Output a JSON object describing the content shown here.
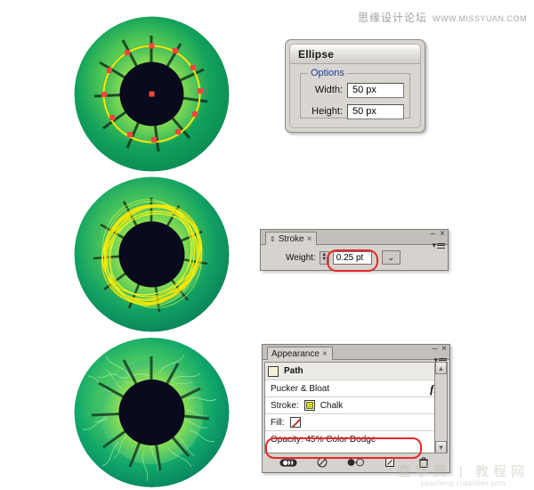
{
  "watermarks": {
    "top_cn": "思缘设计论坛",
    "top_url": "WWW.MISSYUAN.COM",
    "bottom_cn": "查字典 | 教程网",
    "bottom_url": "jiaocheng.chazidian.com"
  },
  "colors": {
    "iris_outer": "#0e9456",
    "iris_mid": "#16a95f",
    "iris_inner": "#8fe050",
    "pupil": "#090a1e",
    "path_stroke": "#ffe400",
    "anchor_point": "#f4473c",
    "highlight_red": "#e8262a",
    "legend_blue": "#1b3f9c",
    "stroke_swatch": "#cfd428",
    "path_swatch": "#f5f3d4"
  },
  "eyes": [
    {
      "name": "eye-step-1-ellipse-path",
      "description": "green iris with yellow circular path and red anchor points"
    },
    {
      "name": "eye-step-2-chalk-stroke",
      "description": "green iris with yellow chalk scribble stroke"
    },
    {
      "name": "eye-step-3-color-dodge",
      "description": "green iris with color dodge 45% chalk texture"
    }
  ],
  "ellipse_dialog": {
    "title": "Ellipse",
    "legend": "Options",
    "fields": [
      {
        "label": "Width:",
        "value": "50 px"
      },
      {
        "label": "Height:",
        "value": "50 px"
      }
    ],
    "window_buttons": {
      "minimize": "–",
      "close": "×"
    }
  },
  "stroke_panel": {
    "tab": "Stroke",
    "tab_grip": "⇕",
    "tab_close": "×",
    "weight_label": "Weight:",
    "weight_value": "0.25 pt",
    "spinner_up": "▲",
    "spinner_down": "▼",
    "dropdown_caret": "⌄",
    "window_buttons": {
      "minimize": "–",
      "close": "×"
    },
    "menu_caret": "▾"
  },
  "appearance_panel": {
    "tab": "Appearance",
    "tab_close": "×",
    "window_buttons": {
      "minimize": "–",
      "close": "×"
    },
    "menu_caret": "▾",
    "rows": [
      {
        "name": "path",
        "label": "Path",
        "swatch": "path-sw",
        "fx": ""
      },
      {
        "name": "pucker-bloat",
        "label": "Pucker & Bloat",
        "fx": "fx"
      },
      {
        "name": "stroke",
        "label": "Stroke:",
        "value": "Chalk"
      },
      {
        "name": "fill",
        "label": "Fill:",
        "value": ""
      },
      {
        "name": "opacity",
        "label": "Opacity: 45% Color Dodge"
      }
    ],
    "scrollbar": {
      "up": "▲",
      "down": "▼"
    },
    "footer_icons": [
      "new-art-basic-appearance-icon",
      "clear-appearance-icon",
      "reduce-to-basic-appearance-icon",
      "duplicate-selected-item-icon",
      "delete-selected-item-icon"
    ]
  }
}
